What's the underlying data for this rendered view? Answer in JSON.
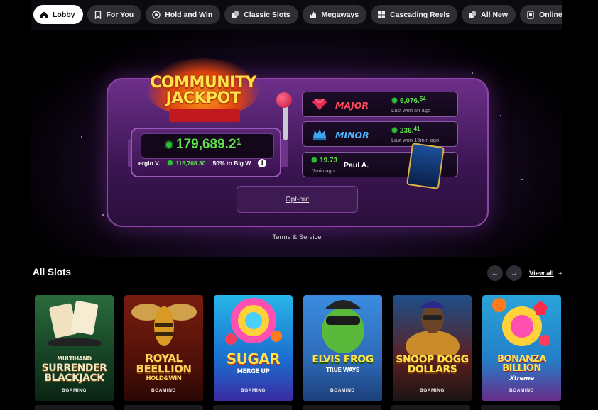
{
  "categories": [
    {
      "label": "Lobby",
      "icon": "home-icon",
      "active": true
    },
    {
      "label": "For You",
      "icon": "bookmark-icon"
    },
    {
      "label": "Hold and Win",
      "icon": "target-icon"
    },
    {
      "label": "Classic Slots",
      "icon": "dice-icon"
    },
    {
      "label": "Megaways",
      "icon": "flame-icon"
    },
    {
      "label": "Cascading Reels",
      "icon": "grid-icon"
    },
    {
      "label": "All New",
      "icon": "dice-icon"
    },
    {
      "label": "Online Slots",
      "icon": "card-icon"
    }
  ],
  "jackpot": {
    "logo_line1": "COMMUNITY",
    "logo_line2": "JACKPOT",
    "main_amount": "179,689.2",
    "main_amount_decimal": "1",
    "last_winner_name": "ergio V.",
    "last_winner_amount": "116,708.30",
    "split_text": "50% to Big W",
    "tiers": [
      {
        "name": "MAJOR",
        "amount": "6,076.",
        "decimal": "54",
        "sub": "Last won 5h ago"
      },
      {
        "name": "MINOR",
        "amount": "236.",
        "decimal": "41",
        "sub": "Last won 15min ago"
      }
    ],
    "recent_win": {
      "amount": "19.73",
      "ago": "7min ago",
      "player": "Paul A."
    },
    "optout_label": "Opt-out",
    "terms_label": "Terms & Service"
  },
  "slots": {
    "heading": "All Slots",
    "view_all_label": "View all",
    "games": [
      {
        "title": "SURRENDER BLACKJACK",
        "subtitle": "MULTIHAND",
        "provider": "BGAMING"
      },
      {
        "title": "ROYAL BEELLION",
        "subtitle": "HOLD&WIN",
        "provider": "BGAMING"
      },
      {
        "title": "SUGAR",
        "subtitle": "MERGE UP",
        "provider": "BGAMING"
      },
      {
        "title": "ELVIS FROG",
        "subtitle": "TRUE WAYS",
        "provider": "BGAMING"
      },
      {
        "title": "SNOOP DOGG DOLLARS",
        "subtitle": "",
        "provider": "BGAMING"
      },
      {
        "title": "BONANZA BILLION",
        "subtitle": "Xtreme",
        "provider": "BGAMING"
      }
    ]
  },
  "colors": {
    "accent_green": "#5ee24a",
    "major_red": "#ff4b5c",
    "minor_blue": "#4fb7ff",
    "panel_purple": "#6d2f8a"
  }
}
